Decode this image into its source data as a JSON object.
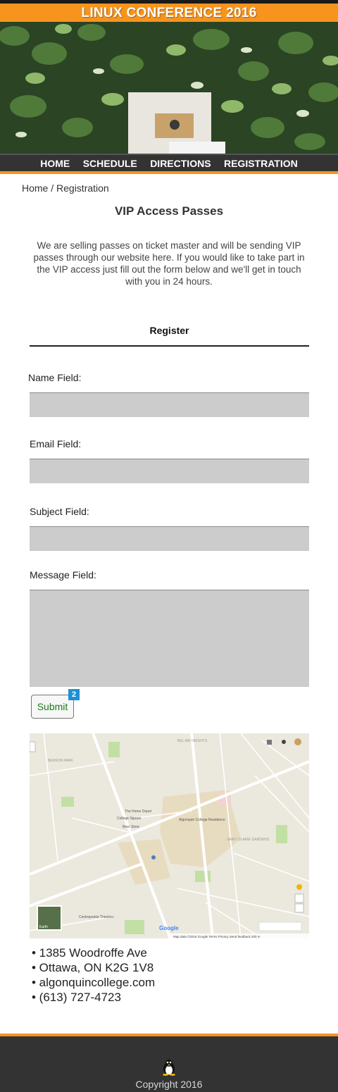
{
  "site": {
    "title": "LINUX CONFERENCE 2016",
    "brand_color": "#f7941d"
  },
  "nav": {
    "items": [
      {
        "label": "HOME"
      },
      {
        "label": "SCHEDULE"
      },
      {
        "label": "DIRECTIONS"
      },
      {
        "label": "REGISTRATION"
      }
    ]
  },
  "breadcrumb": "Home / Registration",
  "main": {
    "title": "VIP Access Passes",
    "intro": "We are selling passes on ticket master and will be sending VIP passes through our website here. If you would like to take part in the VIP access just fill out the form below and we'll get in touch with you in 24 hours."
  },
  "form": {
    "heading": "Register",
    "name_label": "Name Field:",
    "email_label": "Email Field:",
    "subject_label": "Subject Field:",
    "message_label": "Message Field:",
    "name_value": "",
    "email_value": "",
    "subject_value": "",
    "message_value": "",
    "submit_label": "Submit",
    "badge_count": "2"
  },
  "map": {
    "labels": {
      "area1": "BEL AIR HEIGHTS",
      "area2": "SAINT CLAIRE GARDENS",
      "park": "BENSON PARK",
      "home_depot": "The Home Depot",
      "college_square": "College Square",
      "beer_store": "Beer Store",
      "residence": "Algonquin College Residence",
      "theatre": "Centrepointe Theatres",
      "earth": "Earth",
      "google": "Google",
      "footer": "Map data ©2016 Google   Terms   Privacy   Send feedback    200 m"
    },
    "icons": [
      "pegman-icon",
      "zoom-in-icon",
      "zoom-out-icon",
      "satellite-thumbnail"
    ]
  },
  "contact": {
    "items": [
      "• 1385 Woodroffe Ave",
      "• Ottawa, ON K2G 1V8",
      "• algonquincollege.com",
      "• (613) 727-4723"
    ]
  },
  "footer": {
    "copyright": "Copyright 2016",
    "logo_icon": "tux-penguin-icon"
  }
}
